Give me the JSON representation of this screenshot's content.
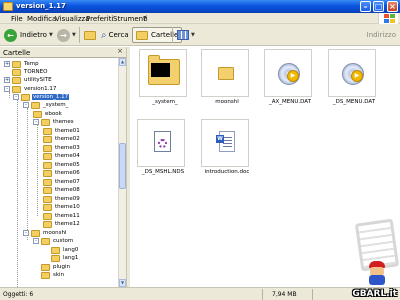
{
  "window": {
    "title": "version_1.17"
  },
  "menu": [
    "File",
    "Modifica",
    "Visualizza",
    "Preferiti",
    "Strumenti",
    "?"
  ],
  "toolbar": {
    "back_label": "Indietro",
    "forward_label": "",
    "search_label": "Cerca",
    "folders_label": "Cartelle",
    "address_label": "Indirizzo"
  },
  "folders_pane": {
    "title": "Cartelle"
  },
  "tree": [
    {
      "label": "Temp",
      "expander": "+"
    },
    {
      "label": "TORNEO",
      "expander": ""
    },
    {
      "label": "utilitySITE",
      "expander": "+"
    },
    {
      "label": "version1.17",
      "expander": "-"
    },
    {
      "label": "version_1.17",
      "expander": "-",
      "selected": true
    },
    {
      "label": "_system_",
      "expander": "-"
    },
    {
      "label": "ebook",
      "expander": ""
    },
    {
      "label": "themes",
      "expander": "-"
    },
    {
      "label": "theme01",
      "expander": ""
    },
    {
      "label": "theme02",
      "expander": ""
    },
    {
      "label": "theme03",
      "expander": ""
    },
    {
      "label": "theme04",
      "expander": ""
    },
    {
      "label": "theme05",
      "expander": ""
    },
    {
      "label": "theme06",
      "expander": ""
    },
    {
      "label": "theme07",
      "expander": ""
    },
    {
      "label": "theme08",
      "expander": ""
    },
    {
      "label": "theme09",
      "expander": ""
    },
    {
      "label": "theme10",
      "expander": ""
    },
    {
      "label": "theme11",
      "expander": ""
    },
    {
      "label": "theme12",
      "expander": ""
    },
    {
      "label": "moonshl",
      "expander": "-"
    },
    {
      "label": "custom",
      "expander": "-"
    },
    {
      "label": "lang0",
      "expander": ""
    },
    {
      "label": "lang1",
      "expander": ""
    },
    {
      "label": "plugin",
      "expander": ""
    },
    {
      "label": "skin",
      "expander": ""
    }
  ],
  "files": [
    {
      "name": "_system_",
      "icon": "folder-with-thumbnail-icon"
    },
    {
      "name": "moonshl",
      "icon": "folder-icon"
    },
    {
      "name": "_AX_MENU.DAT",
      "icon": "media-file-icon"
    },
    {
      "name": "_DS_MENU.DAT",
      "icon": "media-file-icon"
    },
    {
      "name": "_DS_MSHL.NDS",
      "icon": "nds-file-icon"
    },
    {
      "name": "introduction.doc",
      "icon": "word-document-icon"
    }
  ],
  "status": {
    "objects": "Oggetti: 6",
    "size": "7,94 MB",
    "watermark": "GBARL.it"
  },
  "colors": {
    "titlebar": "#0a55e0",
    "selection": "#316ac5",
    "chrome": "#ece9d8"
  }
}
